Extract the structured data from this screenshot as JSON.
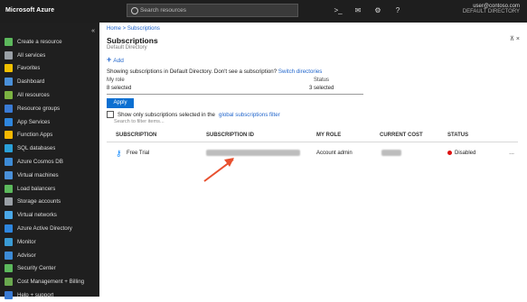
{
  "app": {
    "brand": "Microsoft Azure"
  },
  "topbar": {
    "search_placeholder": "Search resources",
    "icons": [
      "terminal-icon",
      "bell-icon",
      "gear-icon",
      "question-icon"
    ],
    "icon_glyphs": [
      ">_",
      "✉",
      "⚙",
      "?"
    ],
    "account_line1": "user@contoso.com",
    "account_line2": "DEFAULT DIRECTORY"
  },
  "sidebar": {
    "items": [
      {
        "label": "Create a resource",
        "icon": "plus-icon",
        "color": "#5cb85c"
      },
      {
        "label": "All services",
        "icon": "list-icon",
        "color": "#9aa0a6"
      },
      {
        "label": "Favorites",
        "icon": "star-icon",
        "color": "#f0c000"
      },
      {
        "label": "Dashboard",
        "icon": "dashboard-icon",
        "color": "#4a90d9"
      },
      {
        "label": "All resources",
        "icon": "grid-icon",
        "color": "#7cb342"
      },
      {
        "label": "Resource groups",
        "icon": "cube-icon",
        "color": "#3a7bd5"
      },
      {
        "label": "App Services",
        "icon": "globe-icon",
        "color": "#2e86de"
      },
      {
        "label": "Function Apps",
        "icon": "bolt-icon",
        "color": "#f5b800"
      },
      {
        "label": "SQL databases",
        "icon": "database-icon",
        "color": "#2aa0d8"
      },
      {
        "label": "Azure Cosmos DB",
        "icon": "planet-icon",
        "color": "#3d8bd6"
      },
      {
        "label": "Virtual machines",
        "icon": "vm-icon",
        "color": "#4a90d9"
      },
      {
        "label": "Load balancers",
        "icon": "diamond-icon",
        "color": "#5cb85c"
      },
      {
        "label": "Storage accounts",
        "icon": "storage-icon",
        "color": "#9aa0a6"
      },
      {
        "label": "Virtual networks",
        "icon": "network-icon",
        "color": "#4aa8e8"
      },
      {
        "label": "Azure Active Directory",
        "icon": "aad-icon",
        "color": "#2e86de"
      },
      {
        "label": "Monitor",
        "icon": "monitor-icon",
        "color": "#3a9bd5"
      },
      {
        "label": "Advisor",
        "icon": "advisor-icon",
        "color": "#3d8bd6"
      },
      {
        "label": "Security Center",
        "icon": "shield-icon",
        "color": "#5cb85c"
      },
      {
        "label": "Cost Management + Billing",
        "icon": "cost-icon",
        "color": "#6aa84f"
      },
      {
        "label": "Help + support",
        "icon": "help-icon",
        "color": "#3a7bd5"
      }
    ]
  },
  "main": {
    "breadcrumb": "Home > Subscriptions",
    "title": "Subscriptions",
    "subtitle": "Default Directory",
    "window_controls": "⊼ ×",
    "add_label": "Add",
    "info_text": "Showing subscriptions in Default Directory. Don't see a subscription?",
    "info_link": "Switch directories",
    "filter_label": "My role",
    "filter_value": "8 selected",
    "status_label": "Status",
    "status_value": "3 selected",
    "apply_label": "Apply",
    "checkbox_text": "Show only subscriptions selected in the",
    "checkbox_link": "global subscriptions filter",
    "hint": "Search to filter items...",
    "columns": [
      "SUBSCRIPTION",
      "SUBSCRIPTION ID",
      "MY ROLE",
      "CURRENT COST",
      "STATUS"
    ],
    "row": {
      "name": "Free Trial",
      "role": "Account admin",
      "status": "Disabled",
      "more": "..."
    }
  }
}
